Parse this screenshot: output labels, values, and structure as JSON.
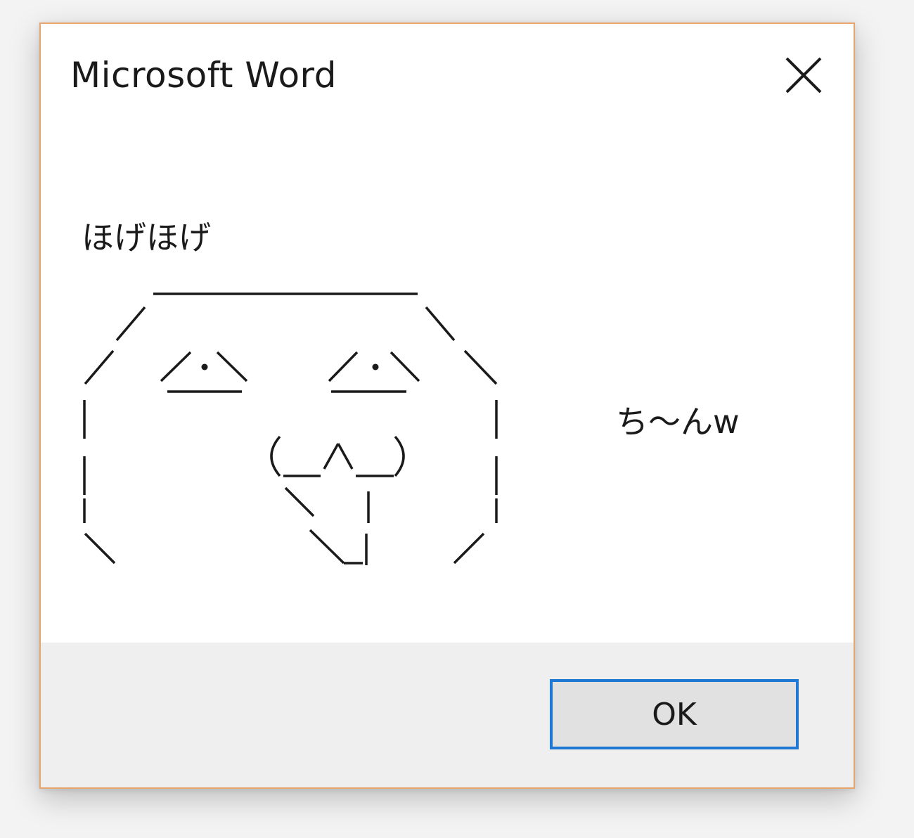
{
  "window": {
    "title": "Microsoft Word"
  },
  "message": {
    "heading": "ほげほげ",
    "side_text": "ち〜んw"
  },
  "buttons": {
    "ok_label": "OK"
  },
  "colors": {
    "window_border": "#e6a56e",
    "button_focus_border": "#1e78d4",
    "footer_background": "#efefef"
  }
}
